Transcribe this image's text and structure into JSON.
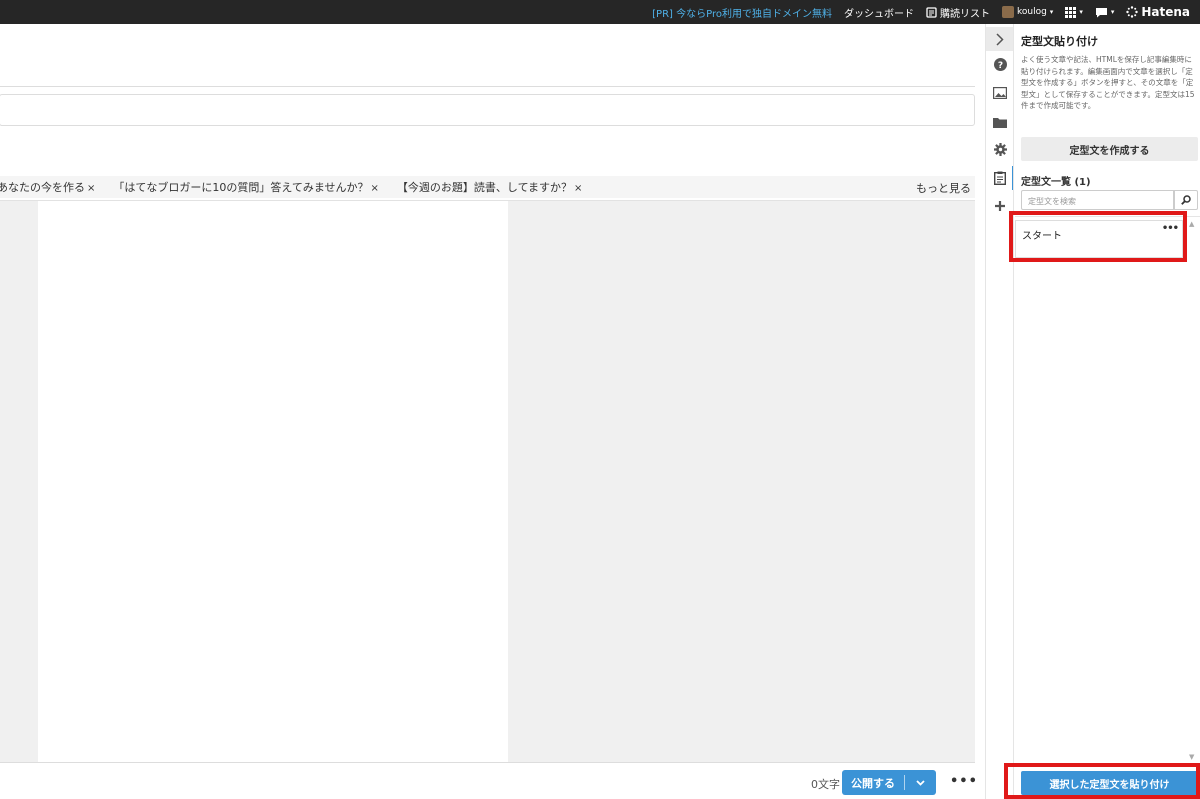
{
  "topbar": {
    "pr_link": "[PR] 今ならPro利用で独自ドメイン無料",
    "dashboard": "ダッシュボード",
    "reading_list": "購読リスト",
    "user": "koulog",
    "brand": "Hatena"
  },
  "tags": [
    {
      "label": "あなたの今を作る",
      "close": "×"
    },
    {
      "label": "「はてなブロガーに10の質問」答えてみませんか？",
      "close": "×"
    },
    {
      "label": "【今週のお題】読書、してますか？",
      "close": "×"
    }
  ],
  "tags_more": "もっと見る",
  "footer": {
    "char_count": "0文字",
    "publish": "公開する",
    "more": "•••"
  },
  "panel": {
    "title": "定型文貼り付け",
    "description": "よく使う文章や記法、HTMLを保存し記事編集時に貼り付けられます。編集画面内で文章を選択し「定型文を作成する」ボタンを押すと、その文章を「定型文」として保存することができます。定型文は15件まで作成可能です。",
    "create_button": "定型文を作成する",
    "list_title": "定型文一覧 (1)",
    "search_placeholder": "定型文を検索",
    "items": [
      {
        "name": "スタート",
        "menu": "•••"
      }
    ],
    "paste_button": "選択した定型文を貼り付け"
  },
  "colors": {
    "accent": "#3b93d6",
    "highlight": "#e01919",
    "topbar": "#262626"
  }
}
